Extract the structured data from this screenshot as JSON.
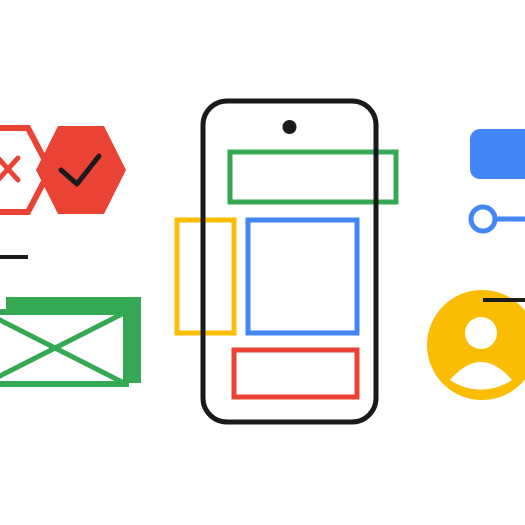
{
  "colors": {
    "background": "#ffffff",
    "outline": "#1a1a1a",
    "red": "#ea4335",
    "green": "#34a853",
    "blue": "#4285f4",
    "yellow": "#fbbc04"
  },
  "icons": [
    "rejected-hexagon-icon",
    "approved-hexagon-icon",
    "placeholder-image-icon",
    "phone-frame-icon",
    "primary-button-icon",
    "slider-icon",
    "avatar-icon"
  ]
}
